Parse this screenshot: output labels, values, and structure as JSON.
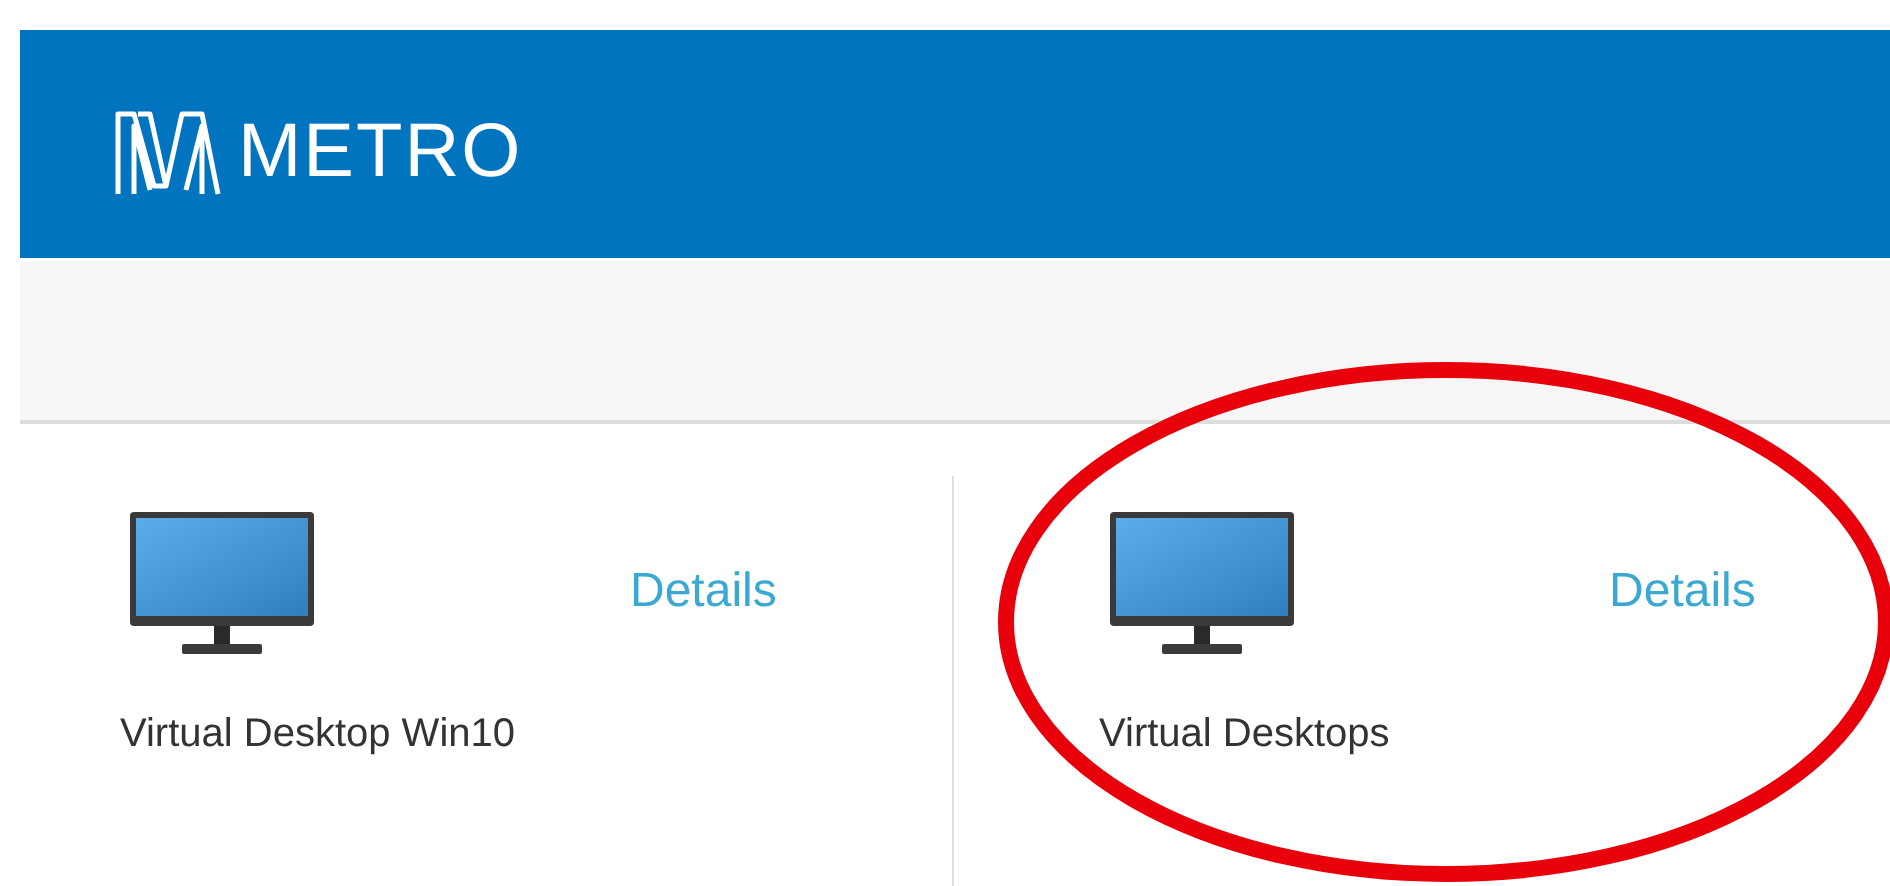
{
  "header": {
    "logo_text": "METRO"
  },
  "tiles": [
    {
      "name": "Virtual Desktop Win10",
      "link": "Details"
    },
    {
      "name": "Virtual Desktops",
      "link": "Details"
    }
  ]
}
